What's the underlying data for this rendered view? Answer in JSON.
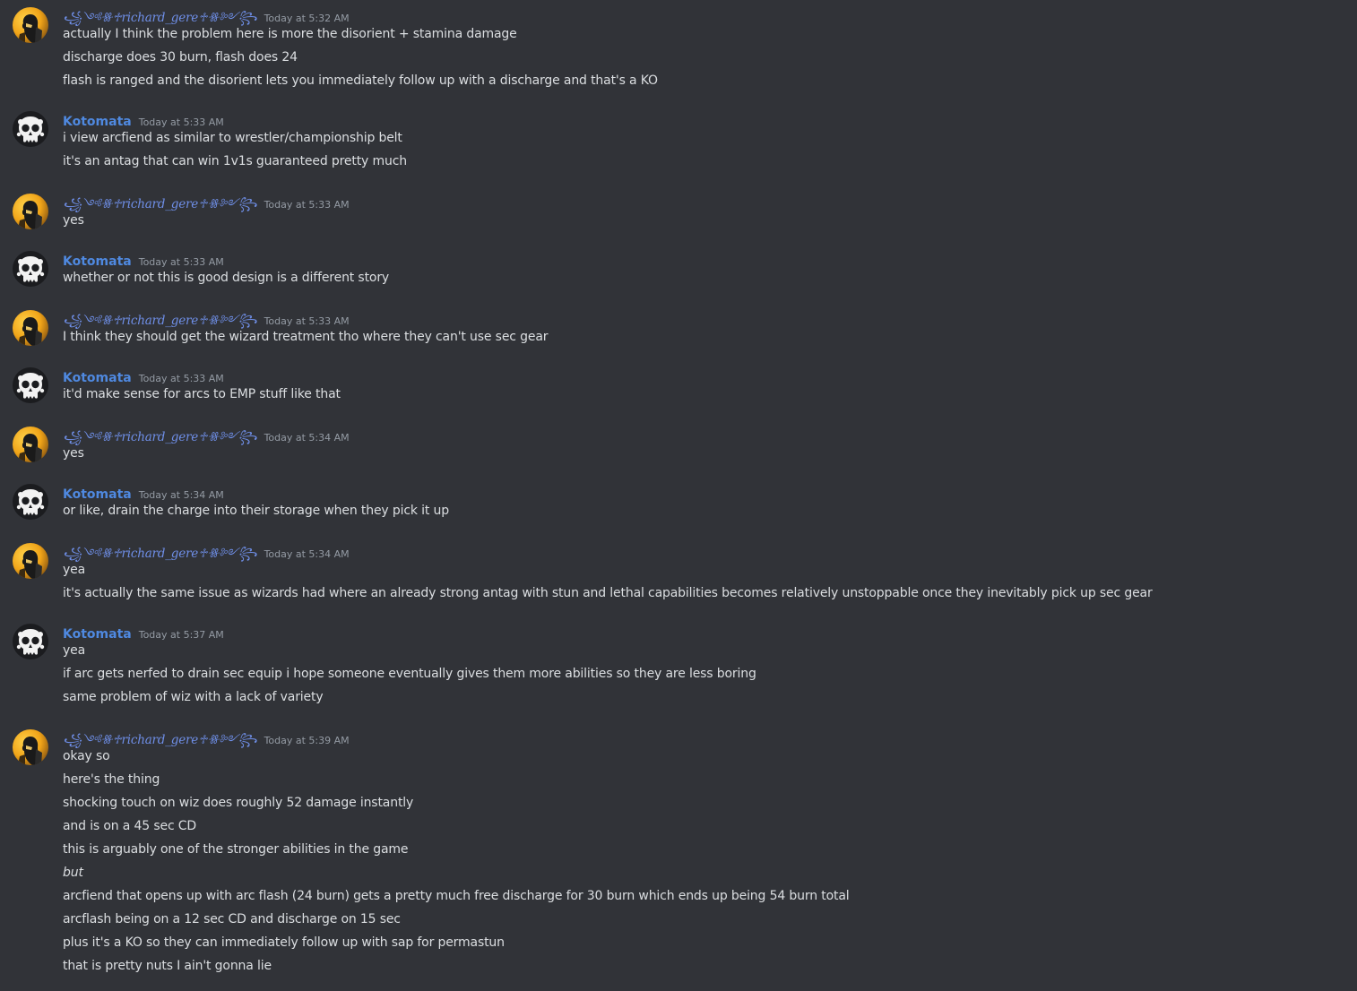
{
  "users": {
    "richard": {
      "name": "꧁༺ꗥ♱richard_gere♱ꗥ༻꧂",
      "avatar": "richard-avatar",
      "color": "#6f8fe8"
    },
    "kotomata": {
      "name": "Kotomata",
      "avatar": "skull-avatar",
      "color": "#4f89e0"
    }
  },
  "messages": [
    {
      "user": "richard",
      "time": "Today at 5:32 AM",
      "lines": [
        "actually I think the problem here is more the disorient + stamina damage",
        "discharge does 30 burn, flash does 24",
        "flash is ranged and the disorient lets you immediately follow up with a discharge and that's a KO"
      ]
    },
    {
      "user": "kotomata",
      "time": "Today at 5:33 AM",
      "lines": [
        "i view arcfiend as similar to wrestler/championship belt",
        "it's an antag that can win 1v1s guaranteed pretty much"
      ]
    },
    {
      "user": "richard",
      "time": "Today at 5:33 AM",
      "lines": [
        "yes"
      ]
    },
    {
      "user": "kotomata",
      "time": "Today at 5:33 AM",
      "lines": [
        "whether or not this is good design is a different story"
      ]
    },
    {
      "user": "richard",
      "time": "Today at 5:33 AM",
      "lines": [
        "I think they should get the wizard treatment tho where they can't use sec gear"
      ]
    },
    {
      "user": "kotomata",
      "time": "Today at 5:33 AM",
      "lines": [
        "it'd make sense for arcs to EMP stuff like that"
      ]
    },
    {
      "user": "richard",
      "time": "Today at 5:34 AM",
      "lines": [
        "yes"
      ]
    },
    {
      "user": "kotomata",
      "time": "Today at 5:34 AM",
      "lines": [
        "or like, drain the charge into their storage when they pick it up"
      ]
    },
    {
      "user": "richard",
      "time": "Today at 5:34 AM",
      "lines": [
        "yea",
        "it's actually the same issue as wizards had where an already strong antag with stun and lethal capabilities becomes relatively unstoppable once they inevitably pick up sec gear"
      ]
    },
    {
      "user": "kotomata",
      "time": "Today at 5:37 AM",
      "lines": [
        "yea",
        "if arc gets nerfed to drain sec equip i hope someone eventually gives them more abilities so they are less boring",
        "same problem of wiz with a lack of variety"
      ]
    },
    {
      "user": "richard",
      "time": "Today at 5:39 AM",
      "lines": [
        "okay so",
        "here's the thing",
        "shocking touch on wiz does roughly 52 damage instantly",
        "and is on a 45 sec CD",
        "this is arguably one of the stronger abilities in the game",
        {
          "text": "but",
          "italic": true
        },
        "arcfiend that opens up with arc flash (24 burn) gets a pretty much free discharge for 30 burn which ends up being 54 burn total",
        "arcflash being on a 12 sec CD and discharge on 15 sec",
        "plus it's a KO so they can immediately follow up with sap for permastun",
        "that is pretty nuts I ain't gonna lie"
      ]
    }
  ]
}
